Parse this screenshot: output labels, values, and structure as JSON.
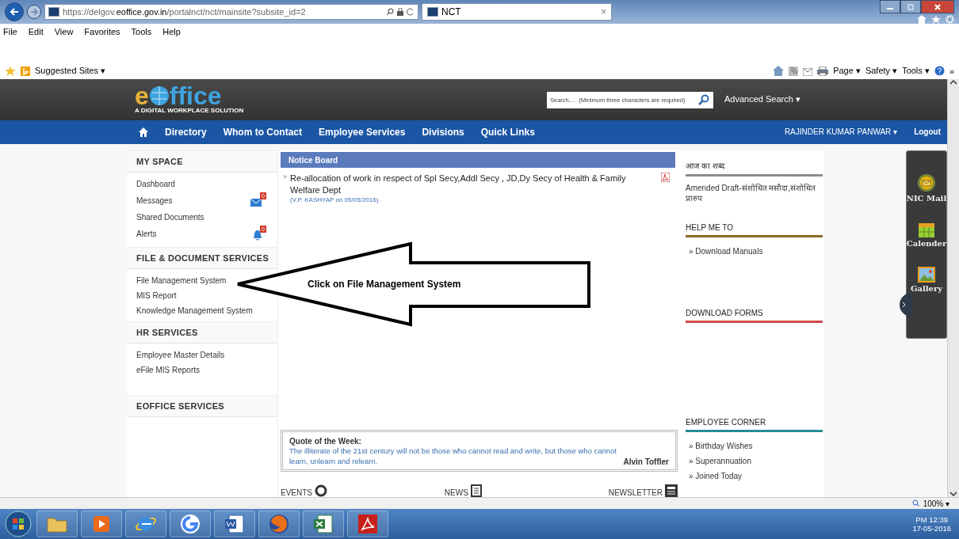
{
  "browser": {
    "url": "https://delgov.**eoffice.gov.in**/portalnct/nct/mainsite?subsite_id=2",
    "tab_title": "NCT",
    "tab_close": "×",
    "menu": [
      "File",
      "Edit",
      "View",
      "Favorites",
      "Tools",
      "Help"
    ],
    "favorites": "Suggested Sites ▾",
    "commands": [
      "Page ▾",
      "Safety ▾",
      "Tools ▾"
    ],
    "more": "»"
  },
  "site": {
    "logo_first": "e",
    "logo_rest": "ffice",
    "tagline": "A DIGITAL WORKPLACE SOLUTION",
    "search_placeholder": "Search....  (Minimum three characters are required)",
    "advanced_search": "Advanced Search ▾",
    "nav": [
      "Directory",
      "Whom to Contact",
      "Employee Services",
      "Divisions",
      "Quick Links"
    ],
    "user": "RAJINDER KUMAR PANWAR ▾",
    "logout": "Logout"
  },
  "sidebar": [
    {
      "title": "MY SPACE",
      "items": [
        {
          "label": "Dashboard",
          "kind": "plain"
        },
        {
          "label": "Messages",
          "kind": "mail",
          "badge": "0"
        },
        {
          "label": "Shared Documents",
          "kind": "plain"
        },
        {
          "label": "Alerts",
          "kind": "alert",
          "badge": "0"
        }
      ]
    },
    {
      "title": "FILE & DOCUMENT SERVICES",
      "items": [
        {
          "label": "File Management System",
          "kind": "plain"
        },
        {
          "label": "MIS Report",
          "kind": "plain"
        },
        {
          "label": "Knowledge Management System",
          "kind": "plain"
        }
      ]
    },
    {
      "title": "HR SERVICES",
      "items": [
        {
          "label": "Employee Master Details",
          "kind": "plain"
        },
        {
          "label": "eFile MIS Reports",
          "kind": "plain"
        }
      ]
    },
    {
      "title": "EOFFICE SERVICES"
    }
  ],
  "notice_board": {
    "title": "Notice Board",
    "items": [
      {
        "bullet": "»",
        "text": "Re-allocation of work in respect of Spl Secy,Addl Secy , JD,Dy Secy of Health & Family Welfare Dept",
        "author": "(V.P. KASHYAP on 05/05/2016)"
      }
    ]
  },
  "callout": {
    "text": "Click on File Management System"
  },
  "quote": {
    "label": "Quote of the Week:",
    "text": "The illiterate of the 21st century will not be those who cannot read and write, but those who cannot learn, unlearn and relearn.",
    "author": "Alvin Toffler"
  },
  "bottom_links": [
    {
      "label": "EVENTS",
      "kind": "events"
    },
    {
      "label": "NEWS",
      "kind": "news"
    },
    {
      "label": "NEWSLETTER",
      "kind": "newsletter"
    }
  ],
  "widgets": [
    {
      "title": "आज का शब्द",
      "color": "#8c8c8c",
      "text": "Amended Draft-संशोधित मसौदा,संशोधित प्रारुप"
    },
    {
      "title": "HELP ME TO",
      "color": "#8a6a2a",
      "items": [
        "» Download Manuals"
      ]
    },
    {
      "title": "DOWNLOAD FORMS",
      "color": "#d24a4a"
    },
    {
      "title": "EMPLOYEE CORNER",
      "color": "#2a8a96",
      "items": [
        "» Birthday Wishes",
        "» Superannuation",
        "» Joined Today"
      ]
    }
  ],
  "side_panel": [
    {
      "label": "NIC Mail",
      "kind": "mail"
    },
    {
      "label": "Calender",
      "kind": "calendar"
    },
    {
      "label": "Gallery",
      "kind": "gallery"
    }
  ],
  "status": {
    "zoom": "100% ▾"
  },
  "taskbar": {
    "apps": [
      {
        "kind": "folder"
      },
      {
        "kind": "media"
      },
      {
        "kind": "ie"
      },
      {
        "kind": "chrome"
      },
      {
        "kind": "word"
      },
      {
        "kind": "firefox"
      },
      {
        "kind": "excel"
      },
      {
        "kind": "pdf"
      }
    ],
    "time": "PM 12:39",
    "date": "17-05-2016"
  }
}
